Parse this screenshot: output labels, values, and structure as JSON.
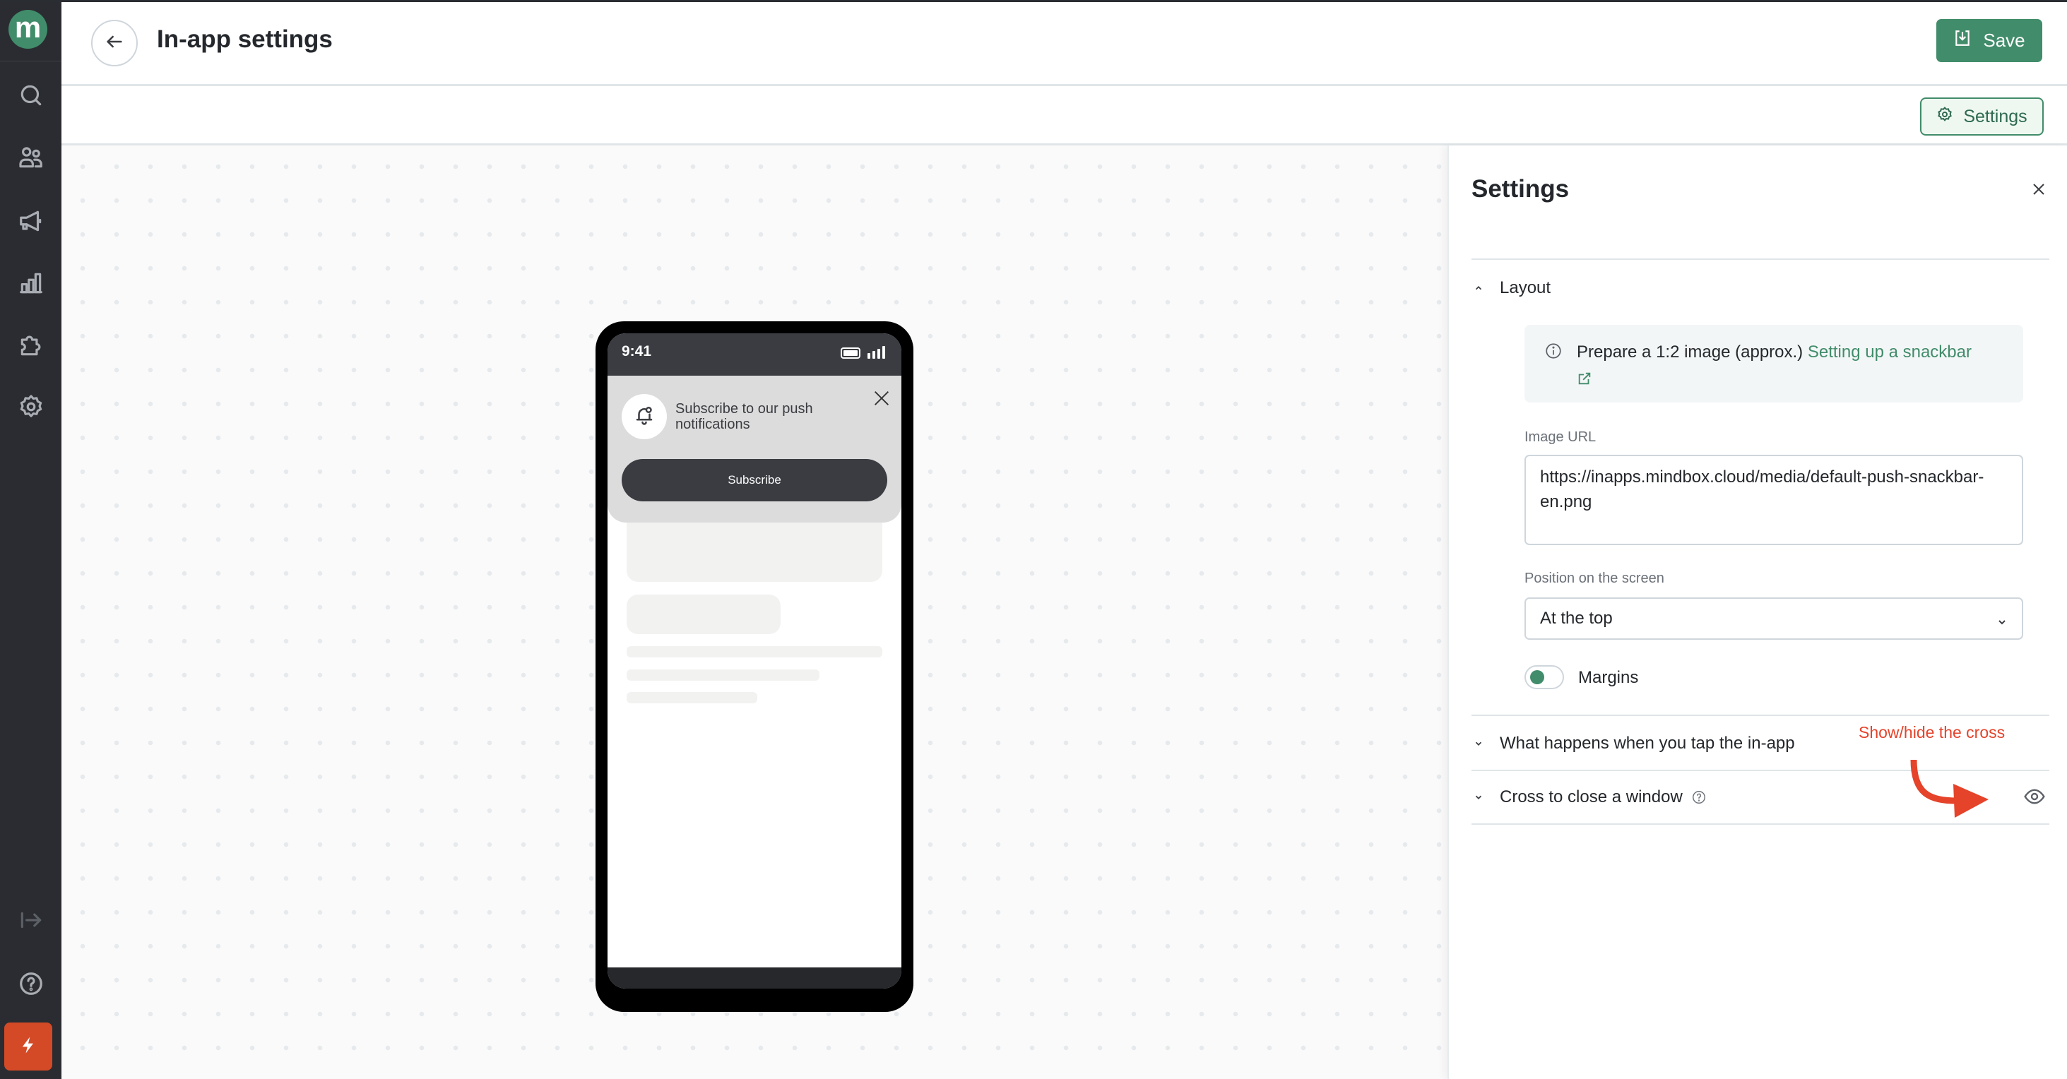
{
  "app": {
    "logo_letter": "m",
    "accent_color": "#418c6a",
    "annotation_color": "#e5432a"
  },
  "sidebar": {
    "items": [
      {
        "name": "search",
        "icon": "search-icon"
      },
      {
        "name": "customers",
        "icon": "users-icon"
      },
      {
        "name": "campaigns",
        "icon": "megaphone-icon"
      },
      {
        "name": "analytics",
        "icon": "bar-chart-icon"
      },
      {
        "name": "integrations",
        "icon": "puzzle-icon"
      },
      {
        "name": "settings",
        "icon": "gear-icon"
      }
    ],
    "bottom_items": [
      {
        "name": "expand",
        "icon": "expand-arrow-icon"
      },
      {
        "name": "help",
        "icon": "help-icon"
      },
      {
        "name": "quick-actions",
        "icon": "bolt-icon"
      }
    ]
  },
  "header": {
    "title": "In-app settings",
    "save_label": "Save"
  },
  "toolbar": {
    "settings_label": "Settings"
  },
  "preview": {
    "status_time": "9:41",
    "snackbar_text": "Subscribe to our push notifications",
    "subscribe_label": "Subscribe"
  },
  "panel": {
    "title": "Settings",
    "sections": {
      "layout": {
        "label": "Layout",
        "expanded": true,
        "info_text": "Prepare a 1:2 image (approx.) ",
        "info_link": "Setting up a snackbar",
        "image_url_label": "Image URL",
        "image_url_value": "https://inapps.mindbox.cloud/media/default-push-snackbar-en.png",
        "position_label": "Position on the screen",
        "position_value": "At the top",
        "margins_label": "Margins",
        "margins_enabled": true
      },
      "tap_action": {
        "label": "What happens when you tap the in-app",
        "expanded": false
      },
      "close_cross": {
        "label": "Cross to close a window",
        "expanded": false,
        "visible": true
      }
    },
    "annotation": "Show/hide the cross"
  }
}
